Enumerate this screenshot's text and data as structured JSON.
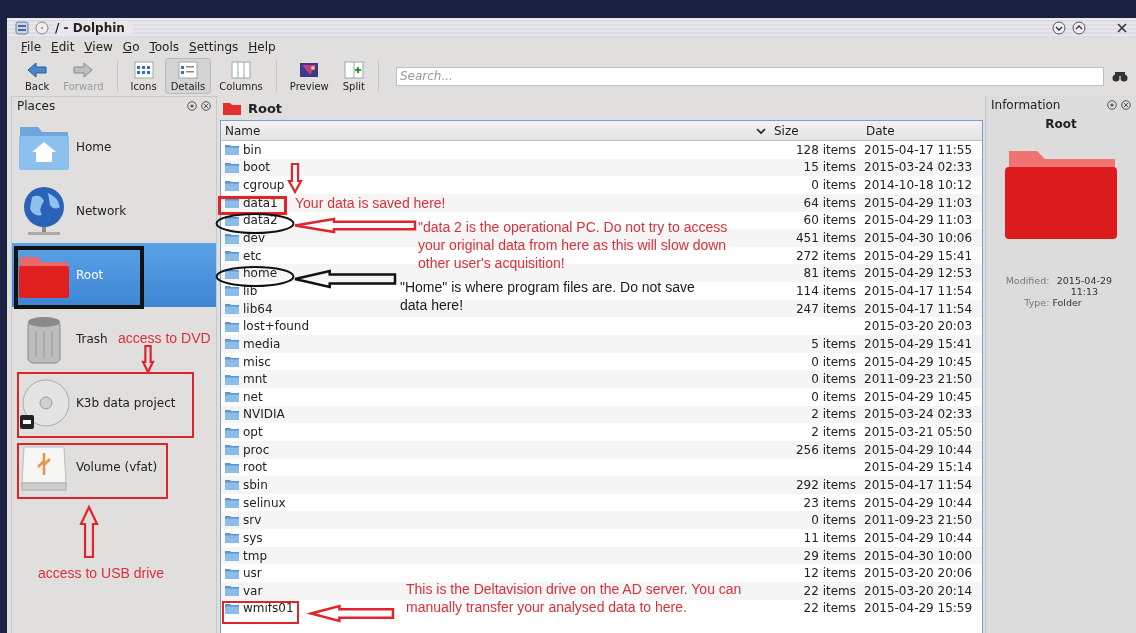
{
  "window": {
    "title": "/ - Dolphin"
  },
  "menu": [
    "File",
    "Edit",
    "View",
    "Go",
    "Tools",
    "Settings",
    "Help"
  ],
  "toolbar": [
    {
      "label": "Back",
      "disabled": false,
      "selected": false
    },
    {
      "label": "Forward",
      "disabled": true,
      "selected": false
    },
    {
      "label": "Icons",
      "disabled": false,
      "selected": false
    },
    {
      "label": "Details",
      "disabled": false,
      "selected": true
    },
    {
      "label": "Columns",
      "disabled": false,
      "selected": false
    },
    {
      "label": "Preview",
      "disabled": false,
      "selected": false
    },
    {
      "label": "Split",
      "disabled": false,
      "selected": false
    }
  ],
  "search": {
    "placeholder": "Search..."
  },
  "places": {
    "title": "Places",
    "items": [
      {
        "label": "Home",
        "selected": false
      },
      {
        "label": "Network",
        "selected": false
      },
      {
        "label": "Root",
        "selected": true
      },
      {
        "label": "Trash",
        "selected": false
      },
      {
        "label": "K3b data project",
        "selected": false
      },
      {
        "label": "Volume (vfat)",
        "selected": false
      }
    ]
  },
  "location": "Root",
  "table": {
    "columns": [
      "Name",
      "Size",
      "Date"
    ],
    "rows": [
      {
        "name": "bin",
        "size": "128 items",
        "date": "2015-04-17 11:55"
      },
      {
        "name": "boot",
        "size": "15 items",
        "date": "2015-03-24 02:33"
      },
      {
        "name": "cgroup",
        "size": "0 items",
        "date": "2014-10-18 10:12"
      },
      {
        "name": "data1",
        "size": "64 items",
        "date": "2015-04-29 11:03"
      },
      {
        "name": "data2",
        "size": "60 items",
        "date": "2015-04-29 11:03"
      },
      {
        "name": "dev",
        "size": "451 items",
        "date": "2015-04-30 10:06"
      },
      {
        "name": "etc",
        "size": "272 items",
        "date": "2015-04-29 15:41"
      },
      {
        "name": "home",
        "size": "81 items",
        "date": "2015-04-29 12:53"
      },
      {
        "name": "lib",
        "size": "114 items",
        "date": "2015-04-17 11:54"
      },
      {
        "name": "lib64",
        "size": "247 items",
        "date": "2015-04-17 11:54"
      },
      {
        "name": "lost+found",
        "date": "2015-03-20 20:03"
      },
      {
        "name": "media",
        "size": "5 items",
        "date": "2015-04-29 15:41"
      },
      {
        "name": "misc",
        "size": "0 items",
        "date": "2015-04-29 10:45"
      },
      {
        "name": "mnt",
        "size": "0 items",
        "date": "2011-09-23 21:50"
      },
      {
        "name": "net",
        "size": "0 items",
        "date": "2015-04-29 10:45"
      },
      {
        "name": "NVIDIA",
        "size": "2 items",
        "date": "2015-03-24 02:33"
      },
      {
        "name": "opt",
        "size": "2 items",
        "date": "2015-03-21 05:50"
      },
      {
        "name": "proc",
        "size": "256 items",
        "date": "2015-04-29 10:44"
      },
      {
        "name": "root",
        "date": "2015-04-29 15:14"
      },
      {
        "name": "sbin",
        "size": "292 items",
        "date": "2015-04-17 11:54"
      },
      {
        "name": "selinux",
        "size": "23 items",
        "date": "2015-04-29 10:44"
      },
      {
        "name": "srv",
        "size": "0 items",
        "date": "2011-09-23 21:50"
      },
      {
        "name": "sys",
        "size": "11 items",
        "date": "2015-04-29 10:44"
      },
      {
        "name": "tmp",
        "size": "29 items",
        "date": "2015-04-30 10:00"
      },
      {
        "name": "usr",
        "size": "12 items",
        "date": "2015-03-20 20:06"
      },
      {
        "name": "var",
        "size": "22 items",
        "date": "2015-03-20 20:14"
      },
      {
        "name": "wmifs01",
        "size": "22 items",
        "date": "2015-04-29 15:59"
      }
    ]
  },
  "information": {
    "title": "Information",
    "name": "Root",
    "fields": [
      {
        "label": "Modified:",
        "value": "2015-04-29 11:13"
      },
      {
        "label": "Type:",
        "value": "Folder"
      }
    ]
  },
  "annotations": [
    {
      "text": "Your data is saved here!",
      "color": "#d9303a"
    },
    {
      "text": "\"data 2 is the operational PC. Do not try to access your original data from here as this will slow down other user's acquisition!",
      "color": "#d9303a"
    },
    {
      "text": "\"Home\" is where program files are. Do not save data here!",
      "color": "#1a1a1a"
    },
    {
      "text": "access to DVD",
      "color": "#d9303a"
    },
    {
      "text": "access to USB drive",
      "color": "#d9303a"
    },
    {
      "text": "This is the Deltavision drive on the AD server. You can manually transfer your analysed data to here.",
      "color": "#d9303a"
    }
  ]
}
